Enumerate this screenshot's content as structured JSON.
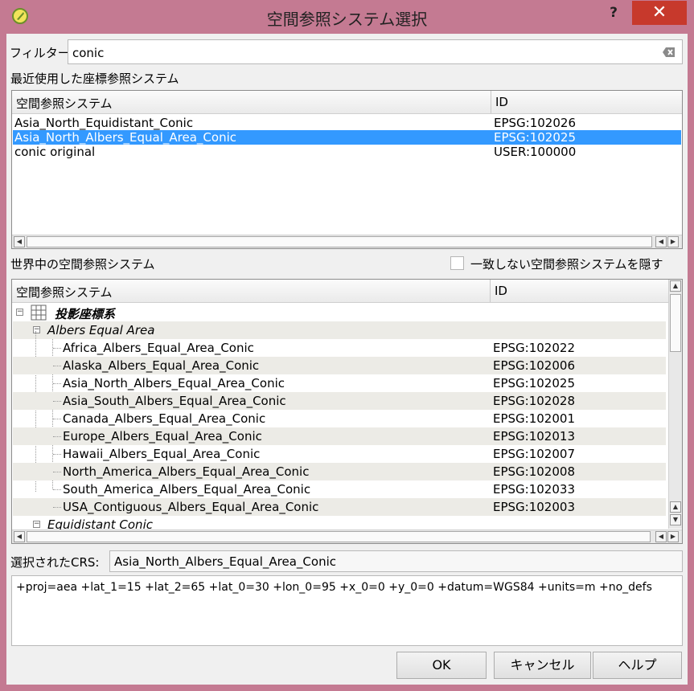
{
  "window": {
    "title": "空間参照システム選択",
    "help_label": "?",
    "close_label": "✕"
  },
  "filter": {
    "label": "フィルター",
    "value": "conic"
  },
  "recent": {
    "section_label": "最近使用した座標参照システム",
    "columns": [
      "空間参照システム",
      "ID"
    ],
    "rows": [
      {
        "name": "Asia_North_Equidistant_Conic",
        "id": "EPSG:102026"
      },
      {
        "name": "Asia_North_Albers_Equal_Area_Conic",
        "id": "EPSG:102025",
        "selected": true
      },
      {
        "name": "conic original",
        "id": "USER:100000"
      }
    ]
  },
  "world": {
    "section_label": "世界中の空間参照システム",
    "hide_checkbox_label": "一致しない空間参照システムを隠す",
    "columns": [
      "空間参照システム",
      "ID"
    ],
    "root_label": "投影座標系",
    "group_label": "Albers Equal Area",
    "items": [
      {
        "name": "Africa_Albers_Equal_Area_Conic",
        "id": "EPSG:102022"
      },
      {
        "name": "Alaska_Albers_Equal_Area_Conic",
        "id": "EPSG:102006"
      },
      {
        "name": "Asia_North_Albers_Equal_Area_Conic",
        "id": "EPSG:102025"
      },
      {
        "name": "Asia_South_Albers_Equal_Area_Conic",
        "id": "EPSG:102028"
      },
      {
        "name": "Canada_Albers_Equal_Area_Conic",
        "id": "EPSG:102001"
      },
      {
        "name": "Europe_Albers_Equal_Area_Conic",
        "id": "EPSG:102013"
      },
      {
        "name": "Hawaii_Albers_Equal_Area_Conic",
        "id": "EPSG:102007"
      },
      {
        "name": "North_America_Albers_Equal_Area_Conic",
        "id": "EPSG:102008"
      },
      {
        "name": "South_America_Albers_Equal_Area_Conic",
        "id": "EPSG:102033"
      },
      {
        "name": "USA_Contiguous_Albers_Equal_Area_Conic",
        "id": "EPSG:102003"
      }
    ],
    "next_group_label": "Equidistant Conic"
  },
  "selected_crs": {
    "label": "選択されたCRS:",
    "value": "Asia_North_Albers_Equal_Area_Conic"
  },
  "proj_string": "+proj=aea +lat_1=15 +lat_2=65 +lat_0=30 +lon_0=95 +x_0=0 +y_0=0 +datum=WGS84 +units=m +no_defs",
  "buttons": {
    "ok": "OK",
    "cancel": "キャンセル",
    "help": "ヘルプ"
  },
  "colors": {
    "titlebar": "#c47a92",
    "close_button": "#c7392c",
    "selection": "#3399ff",
    "alt_row": "#ecebe6"
  }
}
